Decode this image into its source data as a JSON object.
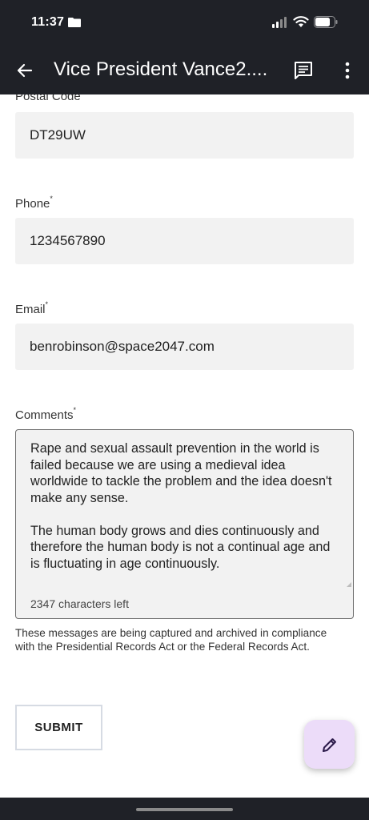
{
  "status_bar": {
    "time": "11:37",
    "icons": [
      "folder-icon",
      "signal-icon",
      "wifi-icon",
      "battery-icon"
    ]
  },
  "app_bar": {
    "title": "Vice President Vance2....",
    "icons": [
      "back-arrow-icon",
      "comment-icon",
      "more-vertical-icon"
    ]
  },
  "form": {
    "postal_code": {
      "label": "Postal Code",
      "value": "DT29UW"
    },
    "phone": {
      "label": "Phone",
      "required_mark": "*",
      "value": "1234567890"
    },
    "email": {
      "label": "Email",
      "required_mark": "*",
      "value": "benrobinson@space2047.com"
    },
    "comments": {
      "label": "Comments",
      "required_mark": "*",
      "value": "Rape and sexual assault prevention in the world is failed because we are using a medieval idea worldwide to tackle the problem and the idea doesn't make any sense.\n\nThe human body grows and dies continuously and therefore the human body is not a continual age and is fluctuating in age continuously.",
      "char_count": "2347 characters left"
    },
    "disclaimer": "These messages are being captured and archived in compliance with the Presidential Records Act or the Federal Records Act.",
    "submit_label": "SUBMIT"
  },
  "fab": {
    "icon": "pencil-icon"
  },
  "colors": {
    "bar_background": "#1f2127",
    "field_background": "#f2f2f2",
    "fab_background": "#ecdcf9",
    "fab_icon": "#2b1a4a",
    "submit_border": "#d6dbe3"
  }
}
